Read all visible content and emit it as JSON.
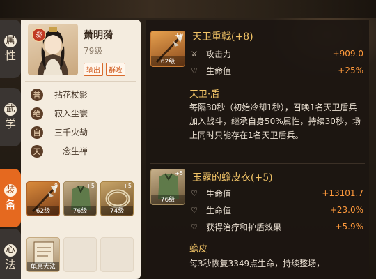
{
  "tabs": [
    {
      "label_top": "属",
      "label_bottom": "性"
    },
    {
      "label_top": "武",
      "label_bottom": "学"
    },
    {
      "label_top": "装",
      "label_bottom": "备"
    },
    {
      "label_top": "心",
      "label_bottom": "法"
    }
  ],
  "character": {
    "element": "炎",
    "name": "萧明漪",
    "level": "79级",
    "roles": [
      "输出",
      "群攻"
    ]
  },
  "skills": [
    {
      "badge": "普",
      "name": "拈花杖影"
    },
    {
      "badge": "绝",
      "name": "寂入尘寰"
    },
    {
      "badge": "自",
      "name": "三千火劫"
    },
    {
      "badge": "天",
      "name": "一念生禅"
    }
  ],
  "equipment": [
    {
      "plus": "+8",
      "level": "62级"
    },
    {
      "plus": "+5",
      "level": "76级"
    },
    {
      "plus": "+5",
      "level": "74级"
    }
  ],
  "methods": [
    {
      "level": "龟息大法"
    }
  ],
  "items": [
    {
      "plus": "+8",
      "level": "62级",
      "title": "天卫重戟(+8)",
      "stats": [
        {
          "icon": "sword-icon",
          "name": "攻击力",
          "value": "+909.0"
        },
        {
          "icon": "heart-icon",
          "name": "生命值",
          "value": "+25%"
        }
      ],
      "effect_title": "天卫·盾",
      "effect_desc": "每隔30秒（初始冷却1秒），召唤1名天卫盾兵加入战斗，继承自身50%属性，持续30秒，场上同时只能存在1名天卫盾兵。"
    },
    {
      "plus": "+5",
      "level": "76级",
      "title": "玉露的蟾皮衣(+5)",
      "stats": [
        {
          "icon": "heart-icon",
          "name": "生命值",
          "value": "+13101.7"
        },
        {
          "icon": "heart-icon",
          "name": "生命值",
          "value": "+23.0%"
        },
        {
          "icon": "heart-icon",
          "name": "获得治疗和护盾效果",
          "value": "+5.9%"
        }
      ],
      "effect_title": "蟾皮",
      "effect_desc": "每3秒恢复3349点生命，持续整场，"
    }
  ]
}
